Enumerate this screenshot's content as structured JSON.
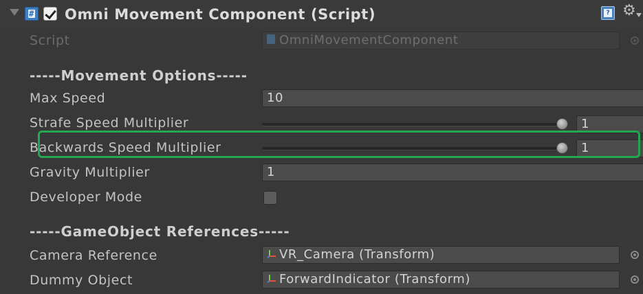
{
  "component": {
    "title": "Omni Movement Component (Script)",
    "enabled": true,
    "script_label": "Script",
    "script_value": "OmniMovementComponent"
  },
  "sections": {
    "movement_options": "-----Movement Options-----",
    "gameobject_references": "-----GameObject References-----"
  },
  "fields": {
    "max_speed": {
      "label": "Max Speed",
      "value": "10"
    },
    "strafe_speed_multiplier": {
      "label": "Strafe Speed Multiplier",
      "value": "1",
      "slider_fraction": 1.0
    },
    "backwards_speed_multiplier": {
      "label": "Backwards Speed Multiplier",
      "value": "1",
      "slider_fraction": 1.0
    },
    "gravity_multiplier": {
      "label": "Gravity Multiplier",
      "value": "1"
    },
    "developer_mode": {
      "label": "Developer Mode",
      "checked": false
    },
    "camera_reference": {
      "label": "Camera Reference",
      "value": "VR_Camera (Transform)"
    },
    "dummy_object": {
      "label": "Dummy Object",
      "value": "ForwardIndicator (Transform)"
    }
  },
  "icons": {
    "foldout": "foldout-arrow-icon",
    "script": "csharp-script-icon",
    "help": "help-book-icon",
    "settings": "gear-icon",
    "object_picker": "object-picker-icon",
    "transform": "transform-icon"
  },
  "colors": {
    "background": "#383838",
    "highlight": "#23a84f",
    "field_bg": "#4b4b4b",
    "script_icon": "#3d7fc4"
  }
}
